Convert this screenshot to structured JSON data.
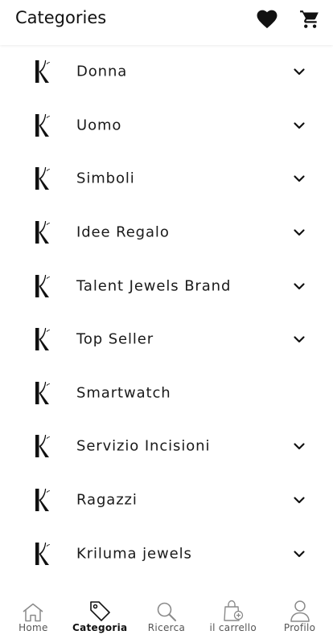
{
  "header": {
    "title": "Categories",
    "favorites_icon": "heart-icon",
    "cart_icon": "shopping-cart-icon"
  },
  "categories": [
    {
      "label": "Donna",
      "logo": "K",
      "expandable": true
    },
    {
      "label": "Uomo",
      "logo": "K",
      "expandable": true
    },
    {
      "label": "Simboli",
      "logo": "K",
      "expandable": true
    },
    {
      "label": "Idee Regalo",
      "logo": "K",
      "expandable": true
    },
    {
      "label": "Talent Jewels Brand",
      "logo": "K",
      "expandable": true
    },
    {
      "label": "Top Seller",
      "logo": "K",
      "expandable": true
    },
    {
      "label": "Smartwatch",
      "logo": "K",
      "expandable": false
    },
    {
      "label": "Servizio Incisioni",
      "logo": "K",
      "expandable": true
    },
    {
      "label": "Ragazzi",
      "logo": "K",
      "expandable": true
    },
    {
      "label": "Kriluma jewels",
      "logo": "K",
      "expandable": true
    }
  ],
  "bottom_nav": {
    "items": [
      {
        "label": "Home",
        "icon": "home-icon",
        "active": false
      },
      {
        "label": "Categoria",
        "icon": "tag-icon",
        "active": true
      },
      {
        "label": "Ricerca",
        "icon": "search-icon",
        "active": false
      },
      {
        "label": "il carrello",
        "icon": "shopping-bag-icon",
        "active": false
      },
      {
        "label": "Profilo",
        "icon": "profile-icon",
        "active": false
      }
    ]
  },
  "colors": {
    "text": "#111111",
    "icon_inactive": "#8a8a8a",
    "background": "#ffffff"
  }
}
